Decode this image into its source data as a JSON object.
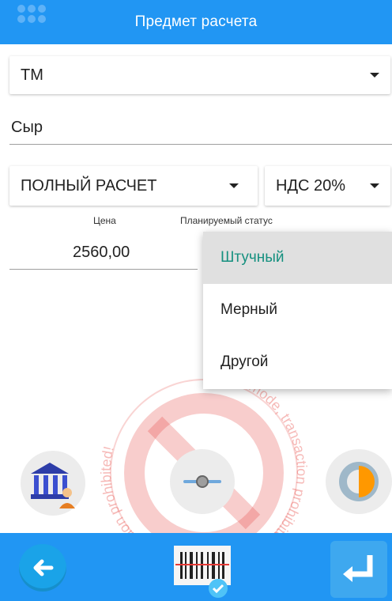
{
  "header": {
    "title": "Предмет расчета"
  },
  "form": {
    "type_value": "ТМ",
    "name_value": "Сыр",
    "payment_method_value": "ПОЛНЫЙ РАСЧЕТ",
    "vat_value": "НДС 20%",
    "price_label": "Цена",
    "price_value": "2560,00",
    "planned_status_label": "Планируемый статус"
  },
  "dropdown": {
    "options": [
      "Штучный",
      "Мерный",
      "Другой"
    ],
    "selected_index": 0
  },
  "colors": {
    "primary": "#2196f3",
    "selected_text": "#15907f",
    "watermark": "#e53935"
  },
  "watermark_text": "Debug mode, transaction prohibited! Debug mode, transaction prohibited!",
  "icons": {
    "bank": "bank-user-icon",
    "slider": "slider-icon",
    "half_circle": "half-circle-icon",
    "back": "back-arrow-icon",
    "scan": "barcode-scan-icon",
    "enter": "enter-icon"
  }
}
